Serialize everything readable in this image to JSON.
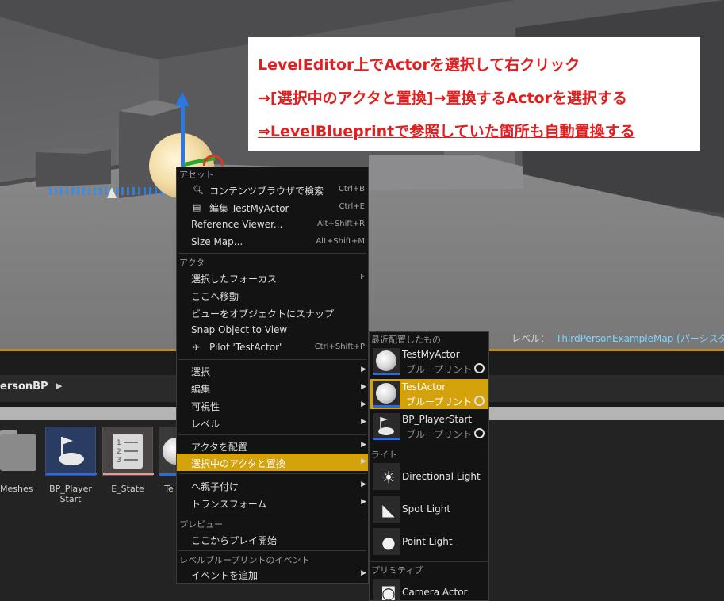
{
  "annotation": {
    "line1": "LevelEditor上でActorを選択して右クリック",
    "line2": "→[選択中のアクタと置換]→置換するActorを選択する",
    "line3": "⇒LevelBlueprintで参照していた箇所も自動置換する"
  },
  "viewport": {
    "level_label": "レベル：",
    "level_name": "ThirdPersonExampleMap (パーシスタン"
  },
  "content_browser": {
    "path_label": "ersonBP",
    "path_arrow": "▶",
    "tiles": [
      {
        "label": "Meshes"
      },
      {
        "label": "BP_Player Start"
      },
      {
        "label": "E_State"
      },
      {
        "label": "Te"
      }
    ]
  },
  "context_menu": {
    "sections": {
      "asset": "アセット",
      "actor": "アクタ",
      "preview": "プレビュー",
      "level_bp_events": "レベルブループリントのイベント"
    },
    "items": {
      "browse": {
        "label": "コンテンツブラウザで検索",
        "shortcut": "Ctrl+B"
      },
      "edit": {
        "label": "編集 TestMyActor",
        "shortcut": "Ctrl+E"
      },
      "ref_viewer": {
        "label": "Reference Viewer...",
        "shortcut": "Alt+Shift+R"
      },
      "size_map": {
        "label": "Size Map...",
        "shortcut": "Alt+Shift+M"
      },
      "focus": {
        "label": "選択したフォーカス",
        "shortcut": "F"
      },
      "move_here": {
        "label": "ここへ移動"
      },
      "snap_view": {
        "label": "ビューをオブジェクトにスナップ"
      },
      "snap_object": {
        "label": "Snap Object to View"
      },
      "pilot": {
        "label": "Pilot 'TestActor'",
        "shortcut": "Ctrl+Shift+P"
      },
      "select": {
        "label": "選択"
      },
      "edit_sub": {
        "label": "編集"
      },
      "visibility": {
        "label": "可視性"
      },
      "level": {
        "label": "レベル"
      },
      "place_actor": {
        "label": "アクタを配置"
      },
      "replace_actor": {
        "label": "選択中のアクタと置換"
      },
      "attach": {
        "label": "へ親子付け"
      },
      "transform": {
        "label": "トランスフォーム"
      },
      "play_here": {
        "label": "ここからプレイ開始"
      },
      "add_event": {
        "label": "イベントを追加"
      }
    },
    "arrow": "▶"
  },
  "submenu": {
    "sections": {
      "recent": "最近配置したもの",
      "lights": "ライト",
      "primitives": "プリミティブ"
    },
    "recent": [
      {
        "name": "TestMyActor",
        "type": "ブループリント"
      },
      {
        "name": "TestActor",
        "type": "ブループリント"
      },
      {
        "name": "BP_PlayerStart",
        "type": "ブループリント"
      }
    ],
    "lights": [
      {
        "name": "Directional Light",
        "icon": "directional-light-icon"
      },
      {
        "name": "Spot Light",
        "icon": "spot-light-icon"
      },
      {
        "name": "Point Light",
        "icon": "point-light-icon"
      }
    ],
    "primitives": [
      {
        "name": "Camera Actor",
        "icon": "camera-icon"
      }
    ]
  },
  "colors": {
    "highlight": "#d4a30c",
    "annotation_text": "#e02020",
    "gizmo_z": "#2a78e6"
  }
}
